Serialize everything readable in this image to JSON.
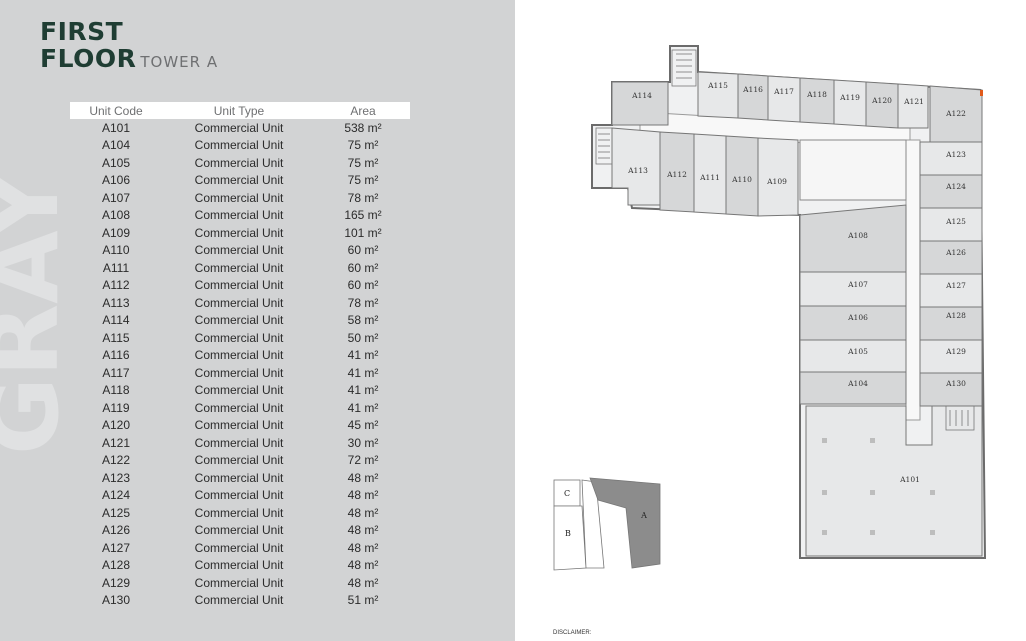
{
  "title": {
    "line1": "FIRST",
    "line2": "FLOOR",
    "tower": "TOWER A"
  },
  "watermark": "GRAY",
  "table": {
    "headers": {
      "code": "Unit Code",
      "type": "Unit Type",
      "area": "Area"
    },
    "rows": [
      {
        "code": "A101",
        "type": "Commercial Unit",
        "area": "538 m²"
      },
      {
        "code": "A104",
        "type": "Commercial Unit",
        "area": "75 m²"
      },
      {
        "code": "A105",
        "type": "Commercial Unit",
        "area": "75 m²"
      },
      {
        "code": "A106",
        "type": "Commercial Unit",
        "area": "75 m²"
      },
      {
        "code": "A107",
        "type": "Commercial Unit",
        "area": "78 m²"
      },
      {
        "code": "A108",
        "type": "Commercial Unit",
        "area": "165 m²"
      },
      {
        "code": "A109",
        "type": "Commercial Unit",
        "area": "101 m²"
      },
      {
        "code": "A110",
        "type": "Commercial Unit",
        "area": "60 m²"
      },
      {
        "code": "A111",
        "type": "Commercial Unit",
        "area": "60 m²"
      },
      {
        "code": "A112",
        "type": "Commercial Unit",
        "area": "60 m²"
      },
      {
        "code": "A113",
        "type": "Commercial Unit",
        "area": "78 m²"
      },
      {
        "code": "A114",
        "type": "Commercial Unit",
        "area": "58 m²"
      },
      {
        "code": "A115",
        "type": "Commercial Unit",
        "area": "50 m²"
      },
      {
        "code": "A116",
        "type": "Commercial Unit",
        "area": "41 m²"
      },
      {
        "code": "A117",
        "type": "Commercial Unit",
        "area": "41 m²"
      },
      {
        "code": "A118",
        "type": "Commercial Unit",
        "area": "41 m²"
      },
      {
        "code": "A119",
        "type": "Commercial Unit",
        "area": "41 m²"
      },
      {
        "code": "A120",
        "type": "Commercial Unit",
        "area": "45 m²"
      },
      {
        "code": "A121",
        "type": "Commercial Unit",
        "area": "30 m²"
      },
      {
        "code": "A122",
        "type": "Commercial Unit",
        "area": "72 m²"
      },
      {
        "code": "A123",
        "type": "Commercial Unit",
        "area": "48 m²"
      },
      {
        "code": "A124",
        "type": "Commercial Unit",
        "area": "48 m²"
      },
      {
        "code": "A125",
        "type": "Commercial Unit",
        "area": "48 m²"
      },
      {
        "code": "A126",
        "type": "Commercial Unit",
        "area": "48 m²"
      },
      {
        "code": "A127",
        "type": "Commercial Unit",
        "area": "48 m²"
      },
      {
        "code": "A128",
        "type": "Commercial Unit",
        "area": "48 m²"
      },
      {
        "code": "A129",
        "type": "Commercial Unit",
        "area": "48 m²"
      },
      {
        "code": "A130",
        "type": "Commercial Unit",
        "area": "51 m²"
      }
    ]
  },
  "plan_labels": {
    "A101": "A101",
    "A104": "A104",
    "A105": "A105",
    "A106": "A106",
    "A107": "A107",
    "A108": "A108",
    "A109": "A109",
    "A110": "A110",
    "A111": "A111",
    "A112": "A112",
    "A113": "A113",
    "A114": "A114",
    "A115": "A115",
    "A116": "A116",
    "A117": "A117",
    "A118": "A118",
    "A119": "A119",
    "A120": "A120",
    "A121": "A121",
    "A122": "A122",
    "A123": "A123",
    "A124": "A124",
    "A125": "A125",
    "A126": "A126",
    "A127": "A127",
    "A128": "A128",
    "A129": "A129",
    "A130": "A130"
  },
  "key_plan": {
    "a": "A",
    "b": "B",
    "c": "C"
  },
  "disclaimer": "DISCLAIMER:",
  "colors": {
    "panel": "#d2d3d4",
    "title": "#1f3d33",
    "unit_fill": "#e7e8e9",
    "unit_fill_dark": "#d6d7d8",
    "wall": "#6b6b6b",
    "accent": "#e05a1a"
  }
}
